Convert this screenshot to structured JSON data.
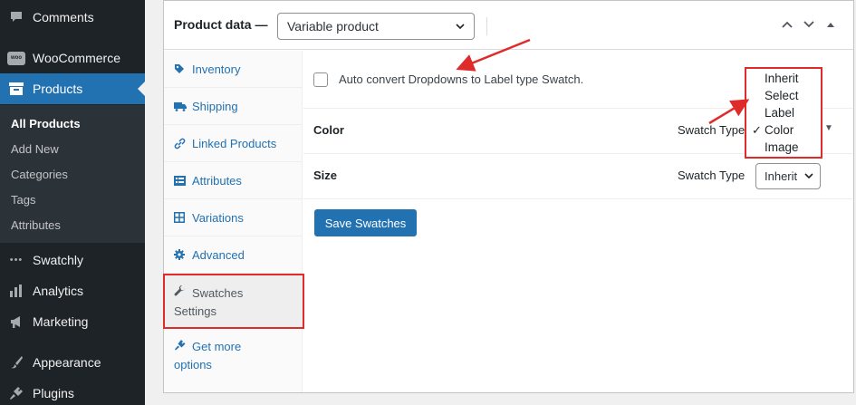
{
  "sidebar": {
    "items": [
      {
        "label": "Comments",
        "icon": "comment-icon"
      },
      {
        "label": "WooCommerce",
        "icon": "woo-icon",
        "badge": "woo"
      },
      {
        "label": "Products",
        "icon": "products-icon"
      },
      {
        "label": "Swatchly",
        "icon": "dots-icon",
        "glyph": "•••"
      },
      {
        "label": "Analytics",
        "icon": "chart-icon"
      },
      {
        "label": "Marketing",
        "icon": "megaphone-icon"
      },
      {
        "label": "Appearance",
        "icon": "brush-icon"
      },
      {
        "label": "Plugins",
        "icon": "plug-icon"
      }
    ],
    "submenu": [
      "All Products",
      "Add New",
      "Categories",
      "Tags",
      "Attributes"
    ]
  },
  "panel": {
    "title": "Product data —",
    "product_type": "Variable product",
    "tabs": [
      {
        "label": "Inventory",
        "icon": "tag-icon"
      },
      {
        "label": "Shipping",
        "icon": "truck-icon"
      },
      {
        "label": "Linked Products",
        "icon": "link-icon"
      },
      {
        "label": "Attributes",
        "icon": "list-icon"
      },
      {
        "label": "Variations",
        "icon": "grid-icon"
      },
      {
        "label": "Advanced",
        "icon": "gear-icon"
      },
      {
        "label_line1": "Swatches",
        "label_line2": "Settings",
        "icon": "wrench-icon"
      },
      {
        "label_line1": "Get more",
        "label_line2": "options",
        "icon": "plug-icon"
      }
    ]
  },
  "content": {
    "auto_convert_label": "Auto convert Dropdowns to Label type Swatch.",
    "attributes": [
      {
        "name": "Color",
        "swatch_label": "Swatch Type",
        "selected": "Color"
      },
      {
        "name": "Size",
        "swatch_label": "Swatch Type",
        "selected": "Inherit"
      }
    ],
    "save_button": "Save Swatches"
  },
  "dropdown": {
    "options": [
      "Inherit",
      "Select",
      "Label",
      "Color",
      "Image"
    ],
    "selected": "Color",
    "check": "✓"
  },
  "colors": {
    "accent": "#2271b1",
    "sidebar_bg": "#1d2327",
    "annotation_red": "#e02b2b"
  }
}
